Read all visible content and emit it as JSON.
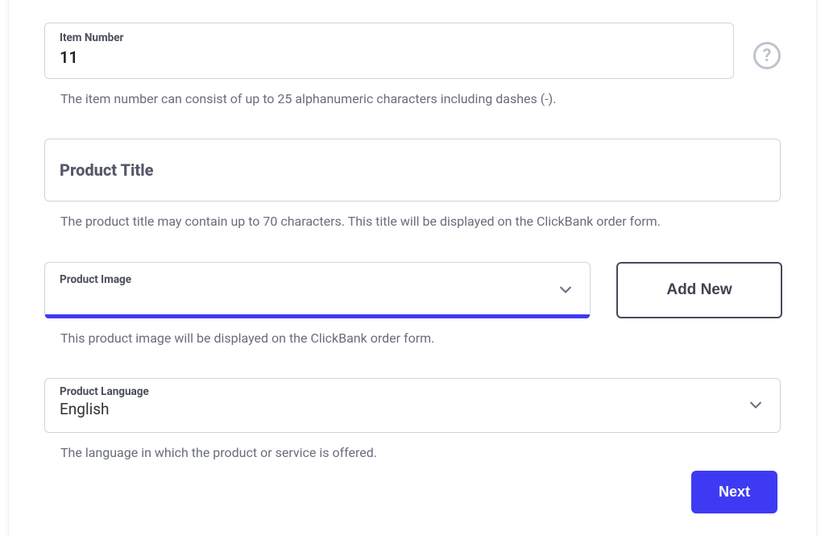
{
  "item_number": {
    "label": "Item Number",
    "value": "11",
    "helper": "The item number can consist of up to 25 alphanumeric characters including dashes (-)."
  },
  "product_title": {
    "label": "Product Title",
    "value": "",
    "helper": "The product title may contain up to 70 characters. This title will be displayed on the ClickBank order form."
  },
  "product_image": {
    "label": "Product Image",
    "value": "",
    "helper": "This product image will be displayed on the ClickBank order form.",
    "add_new_label": "Add New"
  },
  "product_language": {
    "label": "Product Language",
    "value": "English",
    "helper": "The language in which the product or service is offered."
  },
  "footer": {
    "next_label": "Next"
  },
  "help_glyph": "?"
}
